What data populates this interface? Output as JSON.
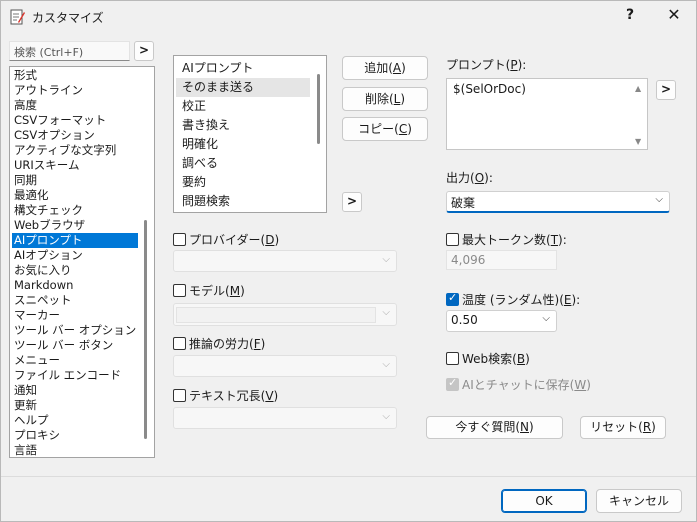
{
  "window": {
    "title": "カスタマイズ",
    "help_label": "?",
    "close_label": "✕"
  },
  "search": {
    "placeholder": "検索 (Ctrl+F)",
    "go_label": ">"
  },
  "categories": {
    "items": [
      "形式",
      "アウトライン",
      "高度",
      "CSVフォーマット",
      "CSVオプション",
      "アクティブな文字列",
      "URIスキーム",
      "同期",
      "最適化",
      "構文チェック",
      "Webブラウザ",
      "AIプロンプト",
      "AIオプション",
      "お気に入り",
      "Markdown",
      "スニペット",
      "マーカー",
      "ツール バー オプション",
      "ツール バー ボタン",
      "メニュー",
      "ファイル エンコード",
      "通知",
      "更新",
      "ヘルプ",
      "プロキシ",
      "言語"
    ],
    "selected": "AIプロンプト"
  },
  "prompt_list": {
    "items": [
      "AIプロンプト",
      "そのまま送る",
      "校正",
      "書き換え",
      "明確化",
      "調べる",
      "要約",
      "問題検索"
    ],
    "selected": "そのまま送る"
  },
  "buttons": {
    "add": "追加",
    "add_key": "A",
    "delete": "削除",
    "delete_key": "L",
    "copy": "コピー",
    "copy_key": "C",
    "move": ">",
    "prompt_insert": ">",
    "ask_now": "今すぐ質問",
    "ask_now_key": "N",
    "reset": "リセット",
    "reset_key": "R",
    "ok": "OK",
    "cancel": "キャンセル"
  },
  "left_options": {
    "provider": {
      "label": "プロバイダー",
      "key": "D",
      "checked": false
    },
    "model": {
      "label": "モデル",
      "key": "M",
      "checked": false
    },
    "reasoning": {
      "label": "推論の労力",
      "key": "F",
      "checked": false
    },
    "verbosity": {
      "label": "テキスト冗長",
      "key": "V",
      "checked": false
    }
  },
  "prompt": {
    "label": "プロンプト",
    "key": "P",
    "value": "$(SelOrDoc)"
  },
  "output": {
    "label": "出力",
    "key": "O",
    "value": "破棄"
  },
  "max_tokens": {
    "label": "最大トークン数",
    "key": "T",
    "checked": false,
    "value": "4,096"
  },
  "temperature": {
    "label": "温度 (ランダム性)",
    "key": "E",
    "checked": true,
    "value": "0.50"
  },
  "web_search": {
    "label": "Web検索",
    "key": "B",
    "checked": false
  },
  "save_chat": {
    "label": "AIとチャットに保存",
    "key": "W",
    "checked": true,
    "disabled": true
  },
  "colors": {
    "accent": "#0067c0",
    "selection": "#0078d7"
  }
}
